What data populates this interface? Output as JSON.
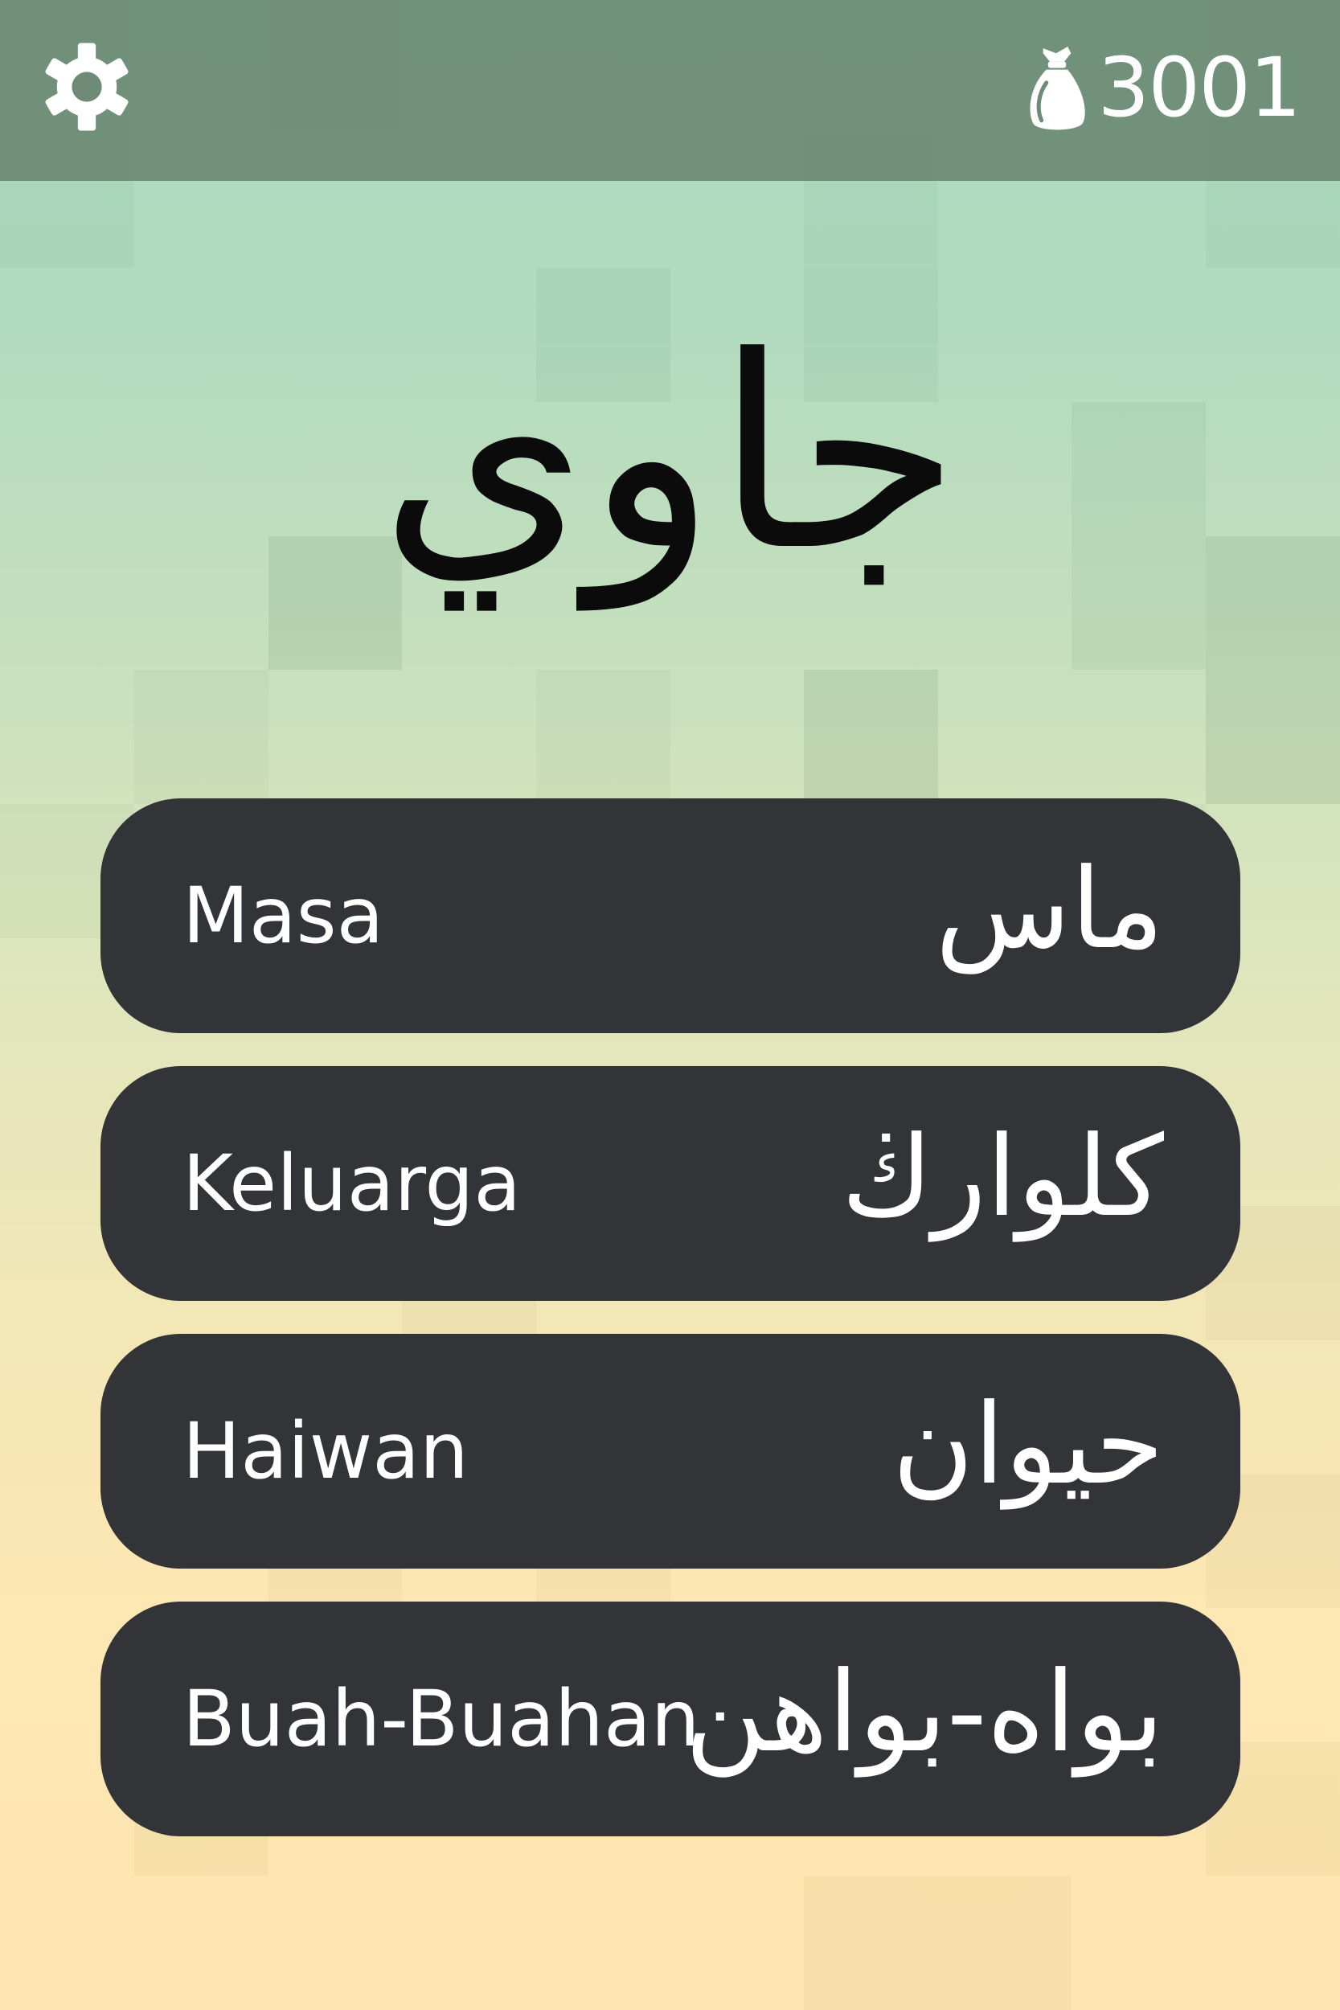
{
  "header": {
    "settings_icon": "gear-icon",
    "coin_icon": "money-bag-icon",
    "coin_count": "3001"
  },
  "title": "جاوي",
  "menu": {
    "items": [
      {
        "latin": "Masa",
        "jawi": "ماس"
      },
      {
        "latin": "Keluarga",
        "jawi": "کلوارڬ"
      },
      {
        "latin": "Haiwan",
        "jawi": "حيوان"
      },
      {
        "latin": "Buah-Buahan",
        "jawi": "بواه-بواهن"
      }
    ]
  },
  "colors": {
    "topbar": "#688670",
    "card": "#333438",
    "text_light": "#ffffff",
    "title_text": "#0b0b0b"
  }
}
